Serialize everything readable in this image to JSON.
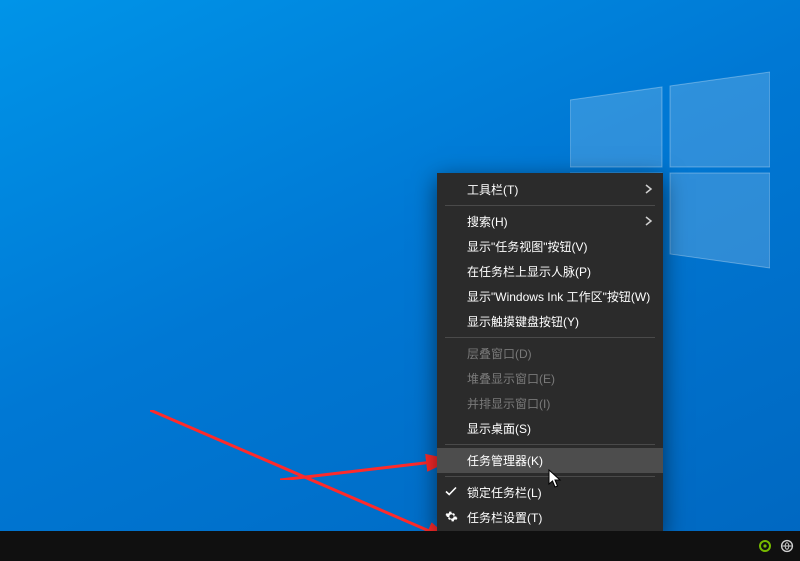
{
  "menu": {
    "toolbars": "工具栏(T)",
    "search": "搜索(H)",
    "show_taskview": "显示\"任务视图\"按钮(V)",
    "show_people": "在任务栏上显示人脉(P)",
    "show_ink": "显示\"Windows Ink 工作区\"按钮(W)",
    "show_touchkb": "显示触摸键盘按钮(Y)",
    "cascade": "层叠窗口(D)",
    "stacked": "堆叠显示窗口(E)",
    "sidebyside": "并排显示窗口(I)",
    "show_desktop": "显示桌面(S)",
    "task_manager": "任务管理器(K)",
    "lock_taskbar": "锁定任务栏(L)",
    "taskbar_settings": "任务栏设置(T)"
  },
  "tray": {
    "nvidia": "nvidia-icon",
    "ime": "ime-icon"
  }
}
